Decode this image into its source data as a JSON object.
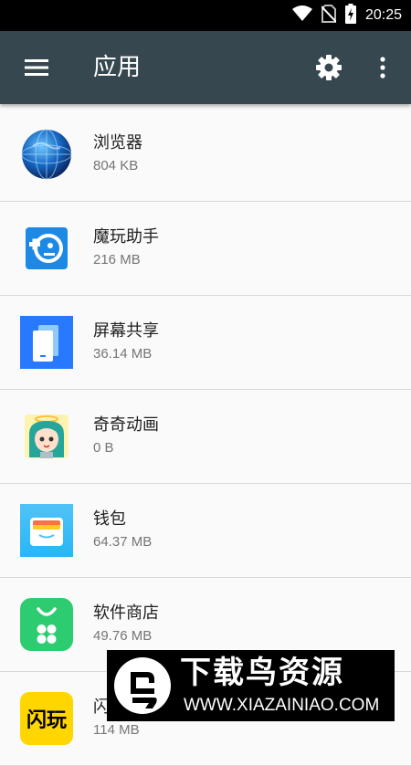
{
  "status_bar": {
    "time": "20:25",
    "icons": [
      "wifi-icon",
      "no-sim-icon",
      "battery-charging-icon"
    ]
  },
  "toolbar": {
    "title": "应用",
    "menu_icon": "hamburger-menu-icon",
    "settings_icon": "gear-icon",
    "more_icon": "more-vert-icon"
  },
  "apps": [
    {
      "name": "浏览器",
      "size": "804 KB",
      "icon": "browser-globe-icon"
    },
    {
      "name": "魔玩助手",
      "size": "216 MB",
      "icon": "mowan-assistant-icon"
    },
    {
      "name": "屏幕共享",
      "size": "36.14 MB",
      "icon": "screen-share-icon"
    },
    {
      "name": "奇奇动画",
      "size": "0 B",
      "icon": "qiqi-anime-icon"
    },
    {
      "name": "钱包",
      "size": "64.37 MB",
      "icon": "wallet-icon"
    },
    {
      "name": "软件商店",
      "size": "49.76 MB",
      "icon": "app-store-icon"
    },
    {
      "name": "闪玩",
      "size": "114 MB",
      "icon": "shanwan-icon",
      "icon_text": "闪玩"
    }
  ],
  "watermark": {
    "title": "下载鸟资源",
    "url": "WWW.XIAZAINIAO.COM"
  },
  "colors": {
    "toolbar": "#37474f",
    "status_bar": "#000000",
    "background": "#fafafa"
  }
}
